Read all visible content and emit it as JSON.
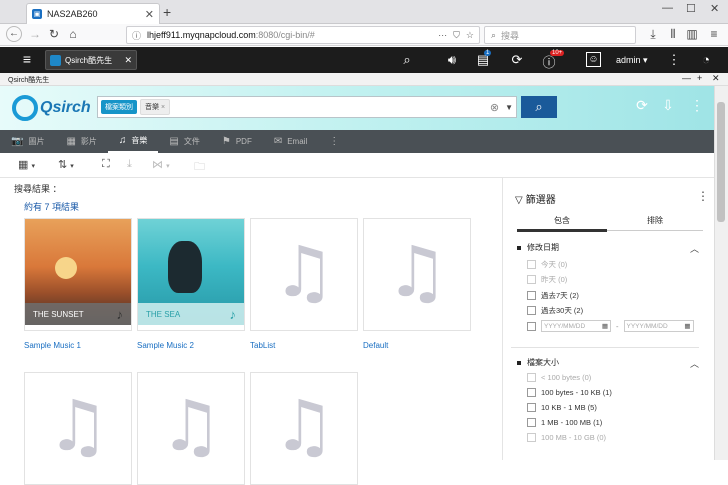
{
  "browser": {
    "tab_title": "NAS2AB260",
    "new_tab": "+",
    "url_host": "lhjeff911.myqnapcloud.com",
    "url_path": ":8080/cgi-bin/#",
    "search_placeholder": "搜尋",
    "win_min": "—",
    "win_max": "☐",
    "win_close": "✕"
  },
  "qts": {
    "app_tab_label": "Qsirch酷先生",
    "user": "admin",
    "notif_count": "10+",
    "task_count": "1"
  },
  "app": {
    "window_title": "Qsirch酷先生",
    "logo_text": "Qsirch",
    "filter_chip": "檔案類別",
    "term_chip": "音樂",
    "term_chip_close": "×"
  },
  "categories": [
    {
      "icon": "📷",
      "label": "圖片"
    },
    {
      "icon": "▦",
      "label": "影片"
    },
    {
      "icon": "♫",
      "label": "音樂"
    },
    {
      "icon": "▤",
      "label": "文件"
    },
    {
      "icon": "⚑",
      "label": "PDF"
    },
    {
      "icon": "✉",
      "label": "Email"
    },
    {
      "icon": "⋮",
      "label": ""
    }
  ],
  "results": {
    "title": "搜尋結果 ：",
    "count": "約有 7 項結果",
    "items": [
      {
        "label": "Sample Music 1",
        "art_text": "THE SUNSET"
      },
      {
        "label": "Sample Music 2",
        "art_text": "THE SEA"
      },
      {
        "label": "TabList",
        "art_text": ""
      },
      {
        "label": "Default",
        "art_text": ""
      },
      {
        "label": "",
        "art_text": ""
      },
      {
        "label": "",
        "art_text": ""
      },
      {
        "label": "",
        "art_text": ""
      }
    ]
  },
  "filter": {
    "title": "篩選器",
    "tab_include": "包含",
    "tab_exclude": "排除",
    "modified": {
      "title": "修改日期",
      "options": [
        {
          "label": "今天 (0)",
          "enabled": false
        },
        {
          "label": "昨天 (0)",
          "enabled": false
        },
        {
          "label": "過去7天 (2)",
          "enabled": true
        },
        {
          "label": "過去30天 (2)",
          "enabled": true
        }
      ],
      "date_from": "YYYY/MM/DD",
      "date_to": "YYYY/MM/DD",
      "date_sep": "-"
    },
    "size": {
      "title": "檔案大小",
      "options": [
        {
          "label": "< 100 bytes (0)",
          "enabled": false
        },
        {
          "label": "100 bytes - 10 KB (1)",
          "enabled": true
        },
        {
          "label": "10 KB - 1 MB (5)",
          "enabled": true
        },
        {
          "label": "1 MB - 100 MB (1)",
          "enabled": true
        },
        {
          "label": "100 MB - 10 GB (0)",
          "enabled": false
        }
      ]
    }
  },
  "colors": {
    "accent": "#1694c8",
    "qts_bar": "#1c1c1c",
    "category_bar": "#4a5055",
    "link": "#1a6fc2"
  }
}
